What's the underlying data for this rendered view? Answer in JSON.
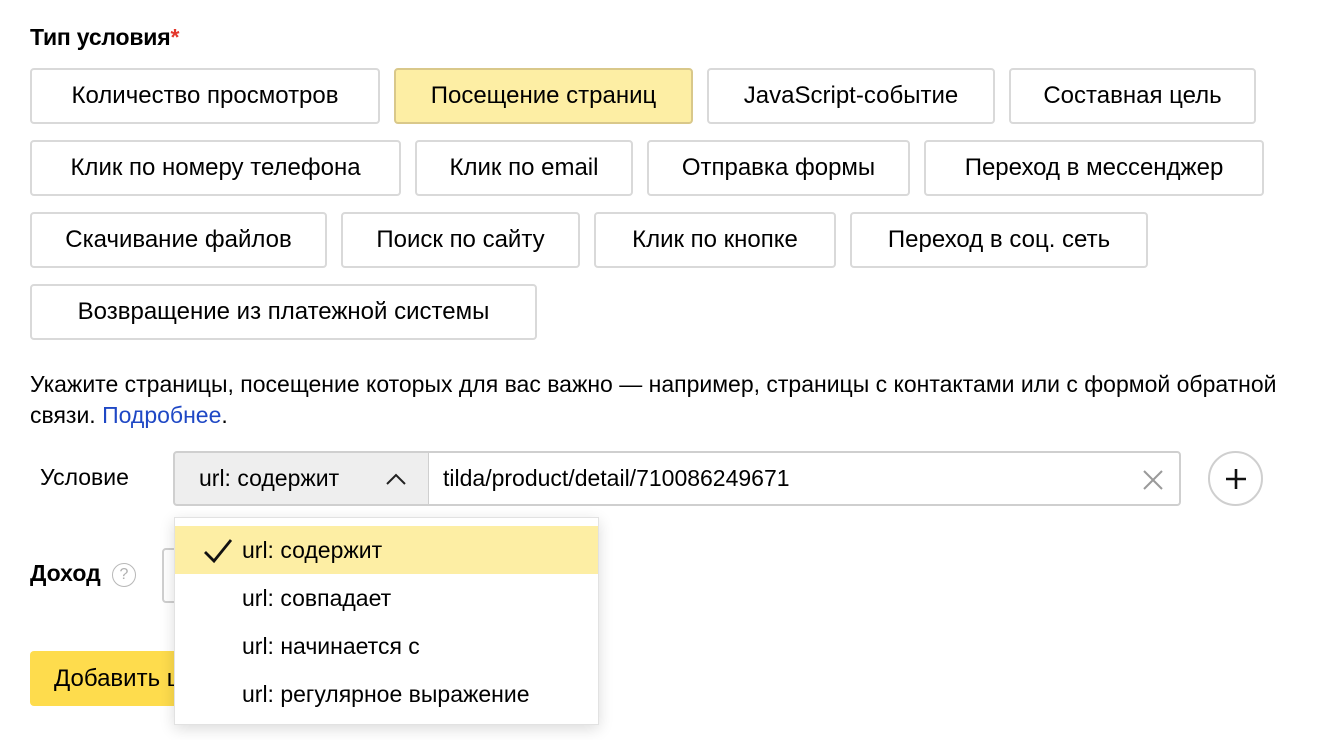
{
  "section": {
    "title": "Тип условия",
    "required_mark": "*"
  },
  "condition_types": [
    {
      "label": "Количество просмотров",
      "selected": false
    },
    {
      "label": "Посещение страниц",
      "selected": true
    },
    {
      "label": "JavaScript-событие",
      "selected": false
    },
    {
      "label": "Составная цель",
      "selected": false
    },
    {
      "label": "Клик по номеру телефона",
      "selected": false
    },
    {
      "label": "Клик по email",
      "selected": false
    },
    {
      "label": "Отправка формы",
      "selected": false
    },
    {
      "label": "Переход в мессенджер",
      "selected": false
    },
    {
      "label": "Скачивание файлов",
      "selected": false
    },
    {
      "label": "Поиск по сайту",
      "selected": false
    },
    {
      "label": "Клик по кнопке",
      "selected": false
    },
    {
      "label": "Переход в соц. сеть",
      "selected": false
    },
    {
      "label": "Возвращение из платежной системы",
      "selected": false
    }
  ],
  "hint": {
    "text": "Укажите страницы, посещение которых для вас важно — например, страницы с контактами или с формой обратной связи. ",
    "link": "Подробнее",
    "tail": "."
  },
  "condition": {
    "label": "Условие",
    "selected_operator": "url: содержит",
    "value": "tilda/product/detail/710086249671",
    "chevron_icon": "chevron-up-icon",
    "clear_icon": "close-icon",
    "add_icon": "plus-icon"
  },
  "dropdown": {
    "options": [
      {
        "label": "url: содержит",
        "checked": true
      },
      {
        "label": "url: совпадает",
        "checked": false
      },
      {
        "label": "url: начинается с",
        "checked": false
      },
      {
        "label": "url: регулярное выражение",
        "checked": false
      }
    ]
  },
  "income": {
    "label": "Доход",
    "help_icon": "question-icon",
    "help_glyph": "?"
  },
  "submit": {
    "label": "Добавить цель"
  },
  "colors": {
    "selected_bg": "#fdeea4",
    "primary_button": "#fedc4d",
    "link": "#1f48c5",
    "required": "#e3372c"
  }
}
